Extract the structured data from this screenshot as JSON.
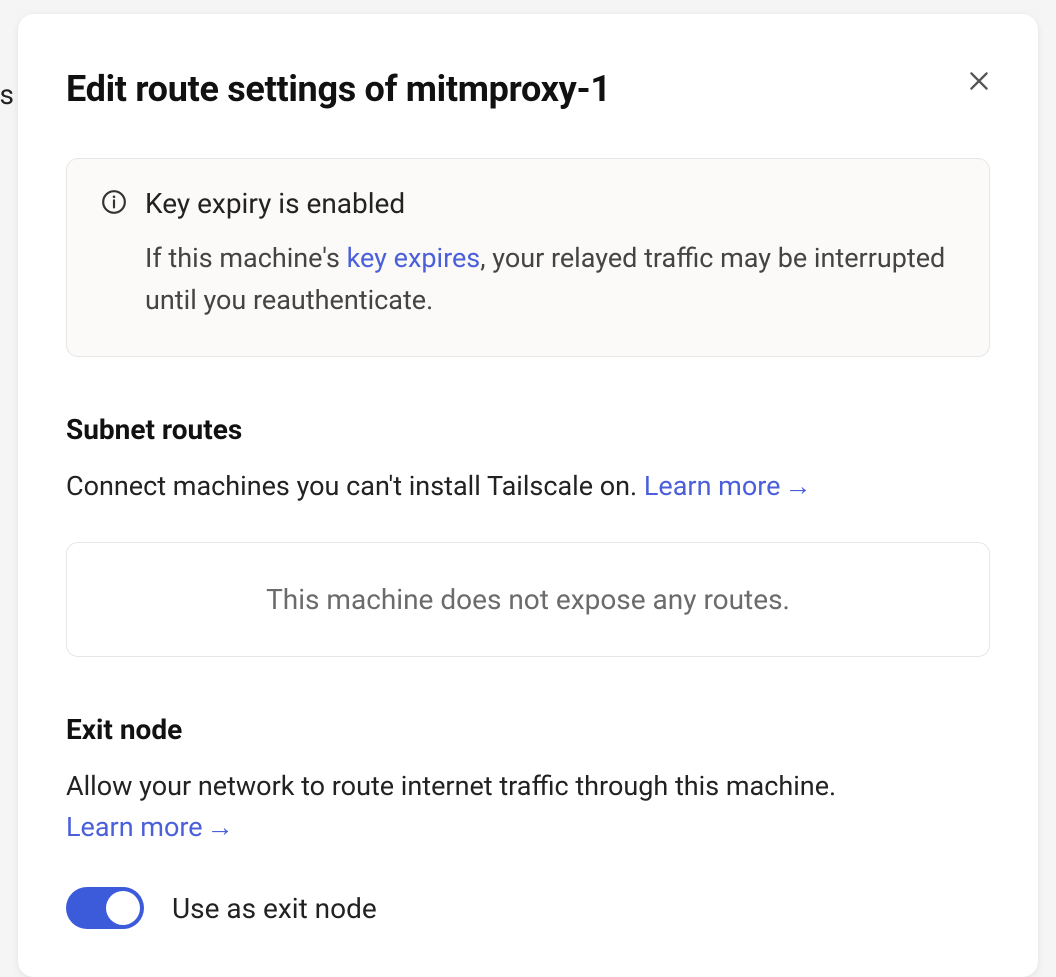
{
  "background": {
    "left_text": "rs"
  },
  "modal": {
    "title": "Edit route settings of mitmproxy-1"
  },
  "callout": {
    "title": "Key expiry is enabled",
    "body_prefix": "If this machine's ",
    "body_link": "key expires",
    "body_suffix": ", your relayed traffic may be interrupted until you reauthenticate."
  },
  "subnet": {
    "title": "Subnet routes",
    "desc": "Connect machines you can't install Tailscale on. ",
    "learn_more": "Learn more",
    "arrow": "→",
    "empty": "This machine does not expose any routes."
  },
  "exit": {
    "title": "Exit node",
    "desc": "Allow your network to route internet traffic through this machine. ",
    "learn_more": "Learn more",
    "arrow": "→",
    "toggle_label": "Use as exit node",
    "toggle_on": true
  }
}
